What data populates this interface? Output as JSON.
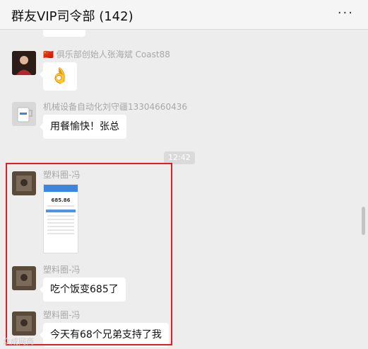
{
  "header": {
    "title": "群友VIP司令部 (142)",
    "more_label": "···"
  },
  "messages": [
    {
      "sender": "🇨🇳 俱乐部创始人张海斌 Coast88",
      "content": "👌"
    },
    {
      "sender": "机械设备自动化刘守疆13304660436",
      "content": "用餐愉快！张总"
    },
    {
      "sender": "塑料圈-冯",
      "content": "685.86"
    },
    {
      "sender": "塑料圈-冯",
      "content": "吃个饭变685了"
    },
    {
      "sender": "塑料圈-冯",
      "content": "今天有68个兄弟支持了我"
    }
  ],
  "time_divider": "12:42",
  "watermark": "众成网商",
  "colors": {
    "highlight": "#e02020",
    "phone_accent": "#3d86e0"
  }
}
